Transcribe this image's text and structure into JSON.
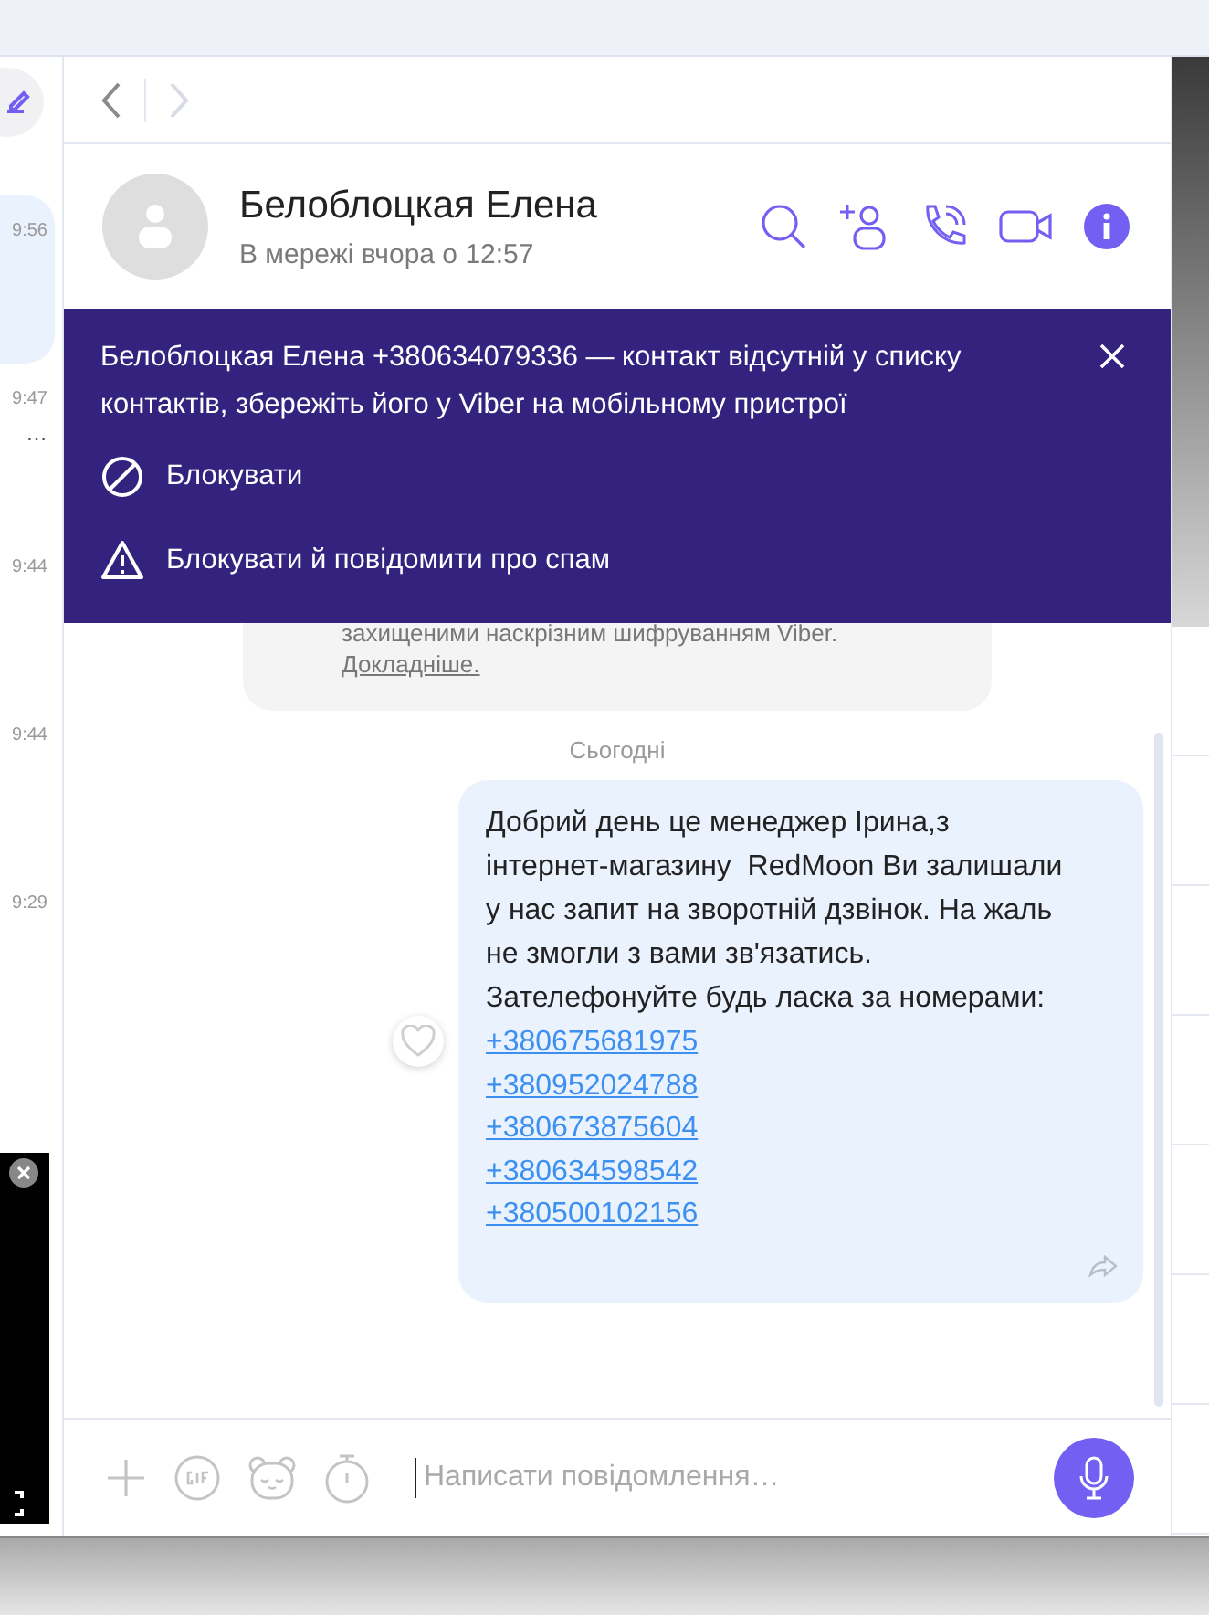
{
  "sidebar": {
    "items": [
      {
        "time": "9:56",
        "selected": true
      },
      {
        "time": "9:47",
        "preview": "…",
        "selected": false
      },
      {
        "time": "9:44",
        "selected": false
      },
      {
        "time": "9:44",
        "selected": false
      },
      {
        "time": "9:29",
        "selected": false
      }
    ]
  },
  "navigation": {
    "back_enabled": true,
    "forward_enabled": false
  },
  "contact": {
    "name": "Белоблоцкая Елена",
    "status": "В мережі вчора о 12:57"
  },
  "banner": {
    "text": "Белоблоцкая Елена +380634079336 — контакт відсутній у списку контактів, збережіть його у Viber на мобільному пристрої",
    "actions": [
      {
        "kind": "block",
        "label": "Блокувати"
      },
      {
        "kind": "report",
        "label": "Блокувати й повідомити про спам"
      }
    ]
  },
  "system_message": {
    "text": "захищеними наскрізним шифруванням Viber.",
    "link": "Докладніше."
  },
  "date_separator": "Сьогодні",
  "messages": [
    {
      "text": "Добрий день це менеджер Ірина,з інтернет-магазину  RedMoon Ви залишали у нас запит на зворотній дзвінок. На жаль не змогли з вами зв'язатись.\nЗателефонуйте будь ласка за номерами:",
      "phones": [
        "+380675681975",
        "+380952024788",
        "+380673875604",
        "+380634598542",
        "+380500102156"
      ],
      "liked": false
    }
  ],
  "composer": {
    "placeholder": "Написати повідомлення…"
  }
}
